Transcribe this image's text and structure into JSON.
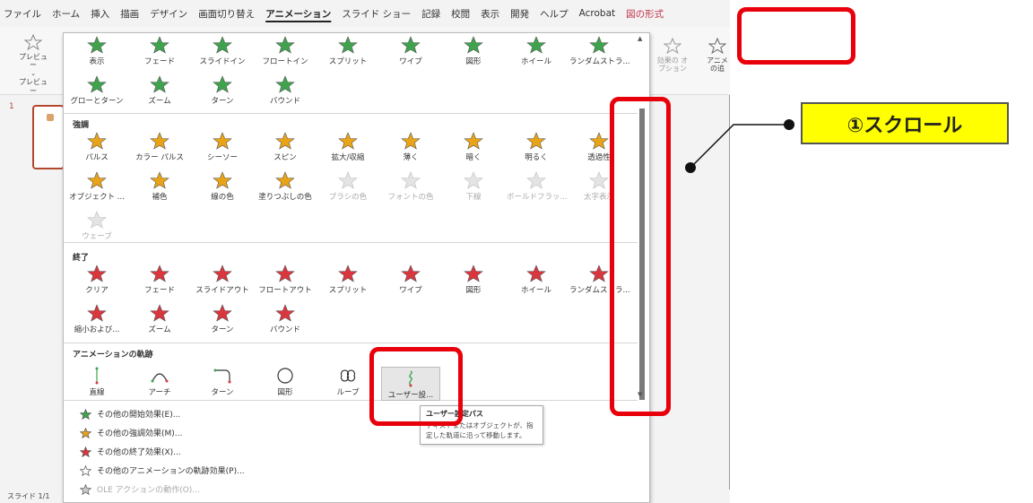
{
  "menu": {
    "items": [
      "ファイル",
      "ホーム",
      "挿入",
      "描画",
      "デザイン",
      "画面切り替え",
      "アニメーション",
      "スライド ショー",
      "記録",
      "校閲",
      "表示",
      "開発",
      "ヘルプ",
      "Acrobat",
      "図の形式"
    ],
    "active_index": 6,
    "contextual_index": 14
  },
  "ribbon": {
    "preview_label": "プレビュー",
    "preview_group": "プレビュー",
    "effect_options_label": "効果の オプション",
    "add_anim_label": "アニメ の追"
  },
  "gallery": {
    "entrance": {
      "items": [
        "表示",
        "フェード",
        "スライドイン",
        "フロートイン",
        "スプリット",
        "ワイプ",
        "図形",
        "ホイール",
        "ランダムストラ...",
        "グローとターン",
        "ズーム",
        "ターン",
        "バウンド"
      ]
    },
    "emphasis": {
      "title": "強調",
      "items": [
        "パルス",
        "カラー パルス",
        "シーソー",
        "スピン",
        "拡大/収縮",
        "薄く",
        "暗く",
        "明るく",
        "透過性",
        "オブジェクト ...",
        "補色",
        "線の色",
        "塗りつぶしの色",
        "ブラシの色",
        "フォントの色",
        "下線",
        "ボールドフラッ...",
        "太字表示",
        "ウェーブ"
      ],
      "disabled": [
        13,
        14,
        15,
        16,
        17,
        18
      ]
    },
    "exit": {
      "title": "終了",
      "items": [
        "クリア",
        "フェード",
        "スライドアウト",
        "フロートアウト",
        "スプリット",
        "ワイプ",
        "図形",
        "ホイール",
        "ランダムストラ...",
        "縮小および...",
        "ズーム",
        "ターン",
        "バウンド"
      ]
    },
    "paths": {
      "title": "アニメーションの軌跡",
      "items": [
        "直線",
        "アーチ",
        "ターン",
        "図形",
        "ループ",
        "ユーザー設..."
      ]
    },
    "more": [
      "その他の開始効果(E)...",
      "その他の強調効果(M)...",
      "その他の終了効果(X)...",
      "その他のアニメーションの軌跡効果(P)...",
      "OLE アクションの動作(O)..."
    ]
  },
  "tooltip": {
    "title": "ユーザー設定パス",
    "body": "テキストまたはオブジェクトが、指定した軌道に沿って移動します。"
  },
  "callout": {
    "text": "①スクロール"
  },
  "status": {
    "slide": "スライド 1/1"
  },
  "thumb": {
    "number": "1"
  },
  "colors": {
    "entrance": "#3fa34d",
    "emphasis": "#e8a317",
    "exit": "#d9363e",
    "annotation": "#e8000b",
    "callout_bg": "#ffff00"
  }
}
